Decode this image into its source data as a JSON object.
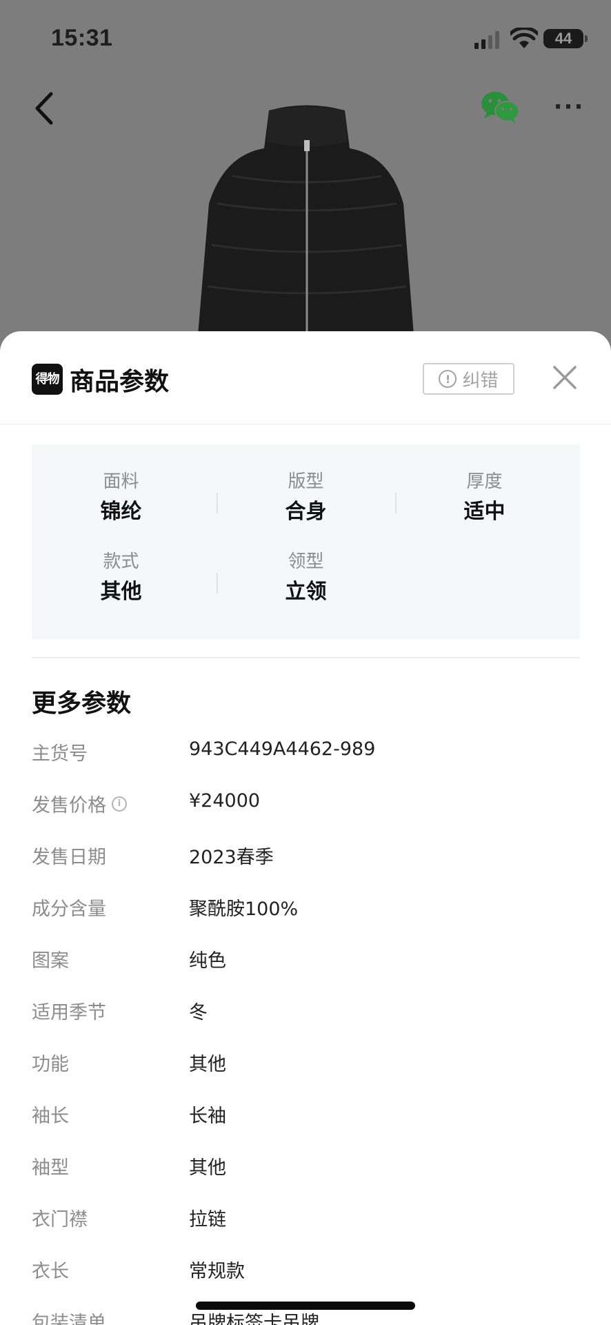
{
  "status_bar": {
    "time": "15:31",
    "battery_level": "44"
  },
  "sheet": {
    "brand_logo_text": "得物",
    "title": "商品参数",
    "report_error_label": "纠错"
  },
  "key_params": [
    {
      "label": "面料",
      "value": "锦纶"
    },
    {
      "label": "版型",
      "value": "合身"
    },
    {
      "label": "厚度",
      "value": "适中"
    },
    {
      "label": "款式",
      "value": "其他"
    },
    {
      "label": "领型",
      "value": "立领"
    }
  ],
  "more_params": {
    "title": "更多参数",
    "rows": [
      {
        "label": "主货号",
        "value": "943C449A4462-989"
      },
      {
        "label": "发售价格",
        "value": "¥24000"
      },
      {
        "label": "发售日期",
        "value": "2023春季"
      },
      {
        "label": "成分含量",
        "value": "聚酰胺100%"
      },
      {
        "label": "图案",
        "value": "纯色"
      },
      {
        "label": "适用季节",
        "value": "冬"
      },
      {
        "label": "功能",
        "value": "其他"
      },
      {
        "label": "袖长",
        "value": "长袖"
      },
      {
        "label": "袖型",
        "value": "其他"
      },
      {
        "label": "衣门襟",
        "value": "拉链"
      },
      {
        "label": "衣长",
        "value": "常规款"
      },
      {
        "label": "包装清单",
        "value": "吊牌标签卡吊牌"
      }
    ]
  },
  "colors": {
    "backdrop": "#7d7d7d",
    "sheet_bg": "#ffffff",
    "panel_bg": "#f6f7f9",
    "label": "#8c8c8c",
    "value": "#111111",
    "wechat_green": "#2a8f3a"
  },
  "icons": [
    "back-icon",
    "wechat-icon",
    "more-icon",
    "alert-icon",
    "close-icon",
    "info-icon",
    "signal-icon",
    "wifi-icon",
    "battery-icon"
  ]
}
